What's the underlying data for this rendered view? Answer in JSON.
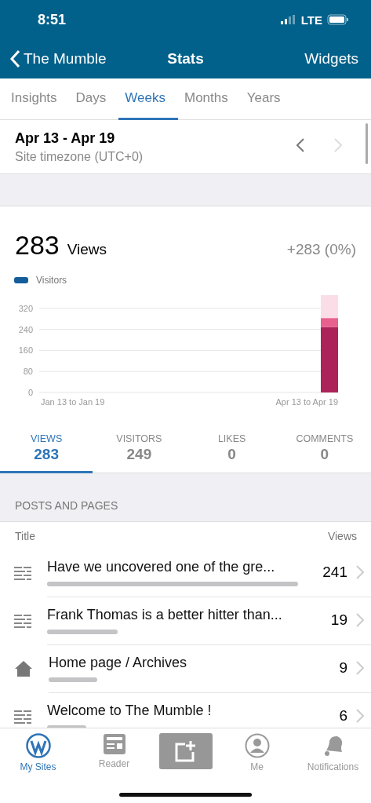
{
  "status_bar": {
    "time": "8:51",
    "network": "LTE"
  },
  "nav": {
    "back": "The Mumble",
    "title": "Stats",
    "action": "Widgets"
  },
  "tabs": [
    {
      "label": "Insights",
      "selected": false
    },
    {
      "label": "Days",
      "selected": false
    },
    {
      "label": "Weeks",
      "selected": true
    },
    {
      "label": "Months",
      "selected": false
    },
    {
      "label": "Years",
      "selected": false
    }
  ],
  "period": {
    "range": "Apr 13 - Apr 19",
    "timezone": "Site timezone (UTC+0)",
    "next_disabled": true
  },
  "summary": {
    "value": "283",
    "unit": "Views",
    "change": "+283 (0%)",
    "chart_data": {
      "type": "bar",
      "stacked": true,
      "grid": true,
      "categories": [
        "Jan 13 to Jan 19",
        "Apr 13 to Apr 19"
      ],
      "ylim": [
        0,
        370
      ],
      "yticks": [
        0,
        80,
        160,
        240,
        320
      ],
      "series": [
        {
          "name": "Visitors",
          "color": "#ab2359",
          "values": [
            0,
            249
          ]
        },
        {
          "color": "#e8608d",
          "values": [
            0,
            34
          ]
        },
        {
          "color": "#fbdde7",
          "values": [
            0,
            87
          ]
        }
      ]
    }
  },
  "stat_tabs": [
    {
      "label": "VIEWS",
      "value": "283",
      "selected": true
    },
    {
      "label": "VISITORS",
      "value": "249",
      "selected": false
    },
    {
      "label": "LIKES",
      "value": "0",
      "selected": false
    },
    {
      "label": "COMMENTS",
      "value": "0",
      "selected": false
    }
  ],
  "posts": {
    "header": "POSTS AND PAGES",
    "columns": [
      "Title",
      "Views"
    ],
    "rows": [
      {
        "kind": "post",
        "title": "Have we uncovered one of the gre...",
        "views": "241"
      },
      {
        "kind": "post",
        "title": "Frank Thomas is a better hitter than...",
        "views": "19"
      },
      {
        "kind": "page",
        "title": "Home page / Archives",
        "views": "9"
      },
      {
        "kind": "post",
        "title": "Welcome to The Mumble !",
        "views": "6"
      }
    ]
  },
  "tab_bar": [
    {
      "kind": "sites",
      "label": "My Sites",
      "selected": true
    },
    {
      "kind": "reader",
      "label": "Reader",
      "selected": false
    },
    {
      "kind": "write"
    },
    {
      "kind": "me",
      "label": "Me",
      "selected": false
    },
    {
      "kind": "notifications",
      "label": "Notifications",
      "selected": false
    }
  ]
}
